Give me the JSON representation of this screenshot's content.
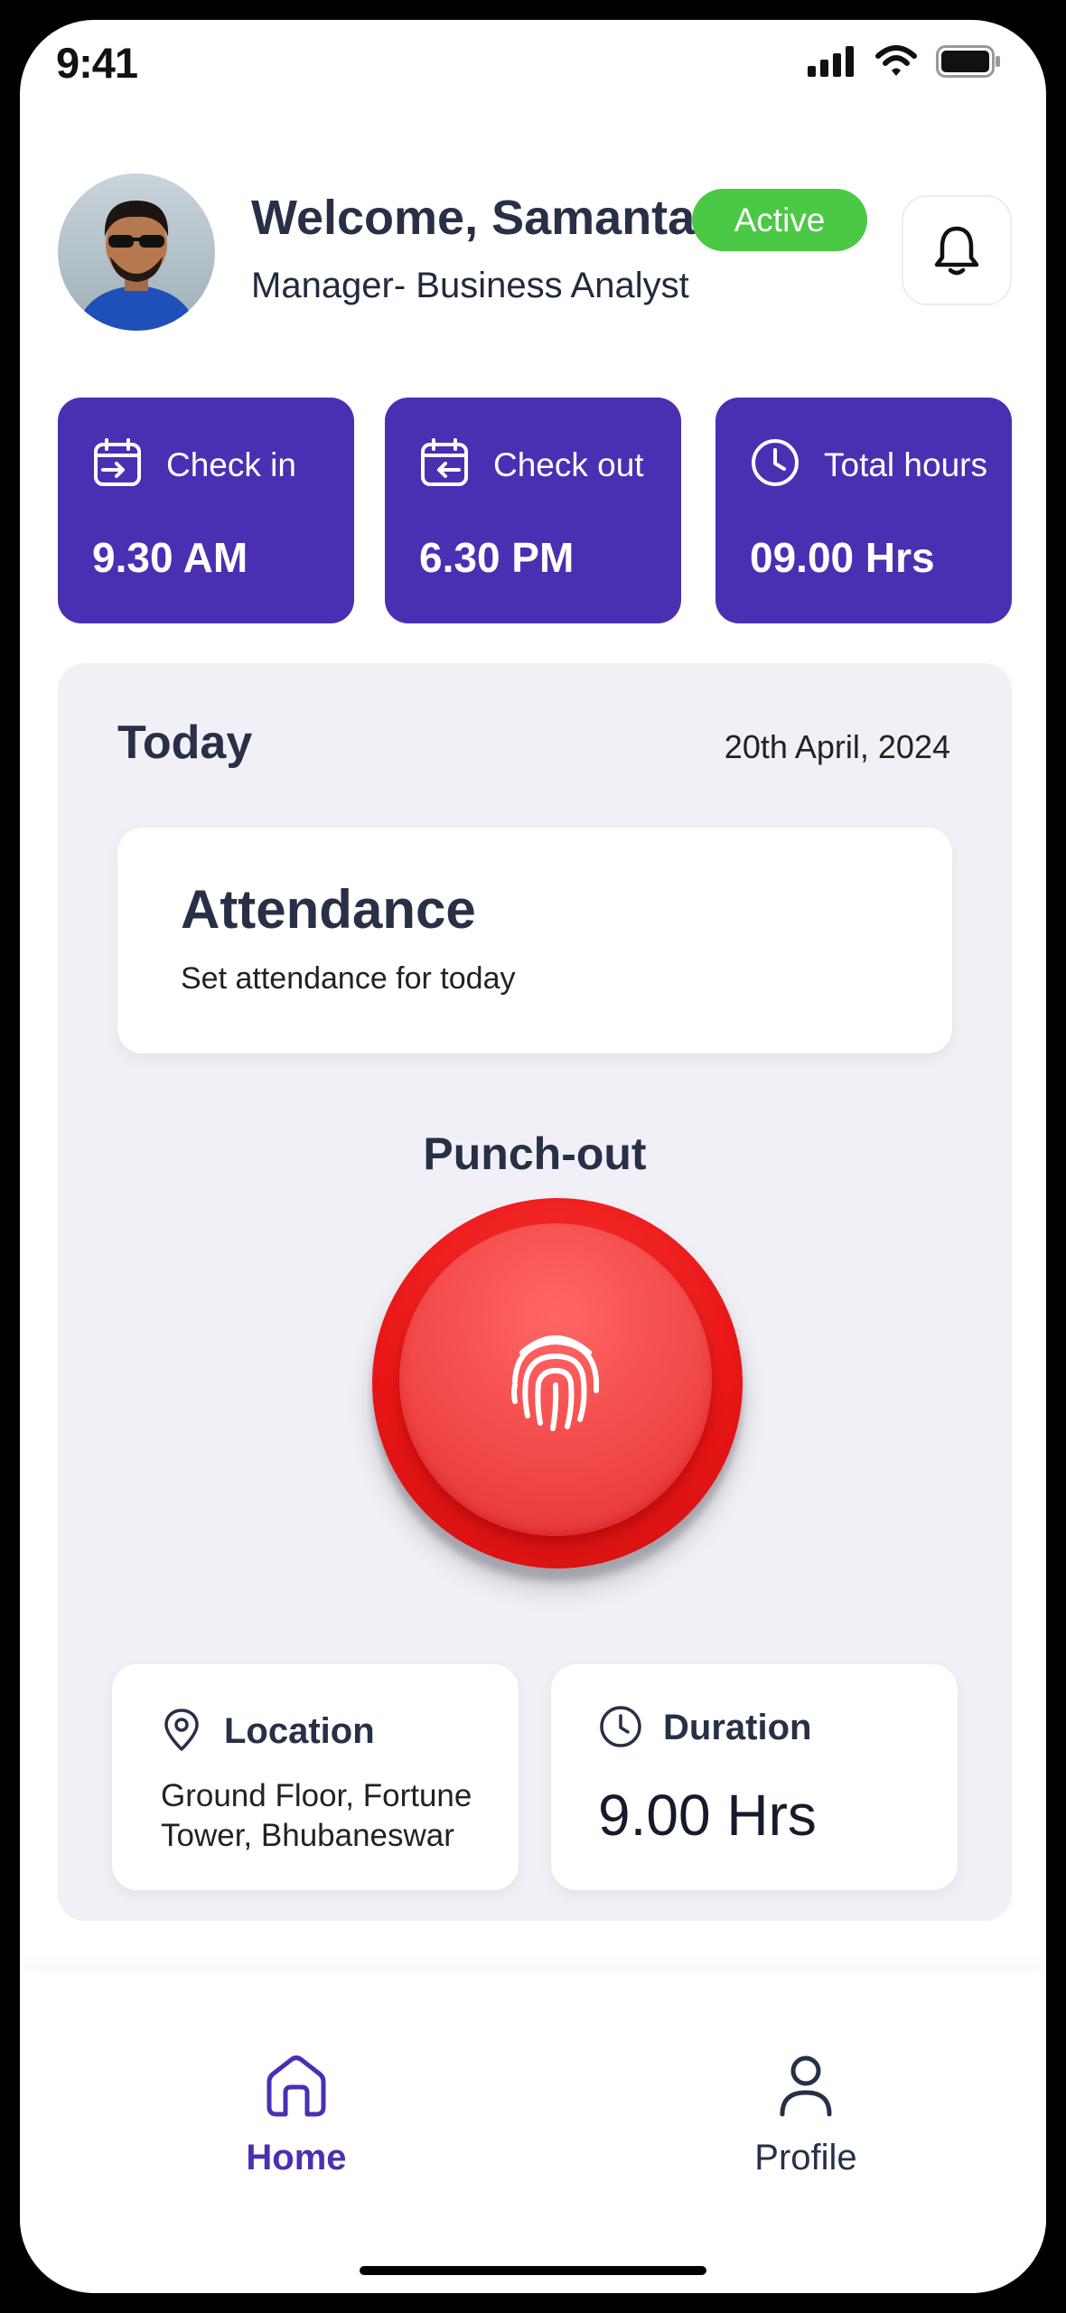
{
  "status_bar": {
    "time": "9:41"
  },
  "header": {
    "welcome": "Welcome, Samanta",
    "status_badge": "Active",
    "role": "Manager- Business Analyst"
  },
  "stats": [
    {
      "label": "Check in",
      "value": "9.30 AM",
      "icon": "calendar-checkin-icon"
    },
    {
      "label": "Check out",
      "value": "6.30 PM",
      "icon": "calendar-checkout-icon"
    },
    {
      "label": "Total hours",
      "value": "09.00 Hrs",
      "icon": "clock-icon"
    }
  ],
  "today": {
    "title": "Today",
    "date": "20th April, 2024",
    "attendance": {
      "title": "Attendance",
      "subtitle": "Set attendance for today"
    },
    "punch_label": "Punch-out",
    "location": {
      "title": "Location",
      "text": "Ground Floor, Fortune Tower, Bhubaneswar"
    },
    "duration": {
      "title": "Duration",
      "value": "9.00 Hrs"
    }
  },
  "nav": {
    "home": "Home",
    "profile": "Profile"
  },
  "colors": {
    "primary": "#4a2fb2",
    "active_badge": "#4cc847",
    "punch": "#e81616",
    "panel_bg": "#f1f0f7",
    "text_dark": "#283047"
  }
}
